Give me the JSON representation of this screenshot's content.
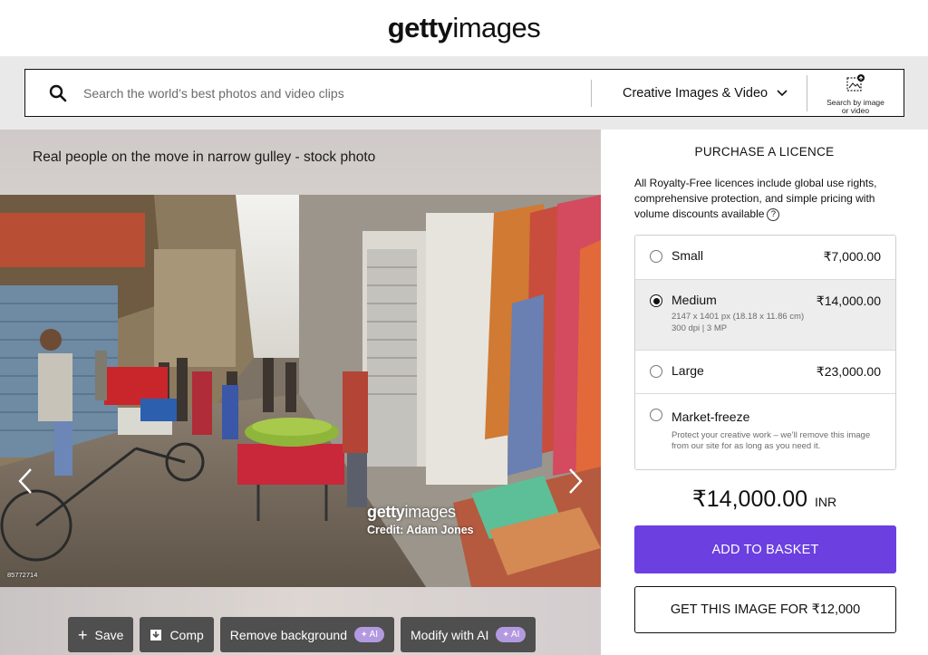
{
  "brand": {
    "bold": "getty",
    "light": "images"
  },
  "search": {
    "placeholder": "Search the world’s best photos and video clips",
    "scope_label": "Creative Images & Video",
    "image_search_label": "Search by image or video"
  },
  "asset": {
    "title": "Real people on the move in narrow gulley - stock photo",
    "watermark_bold": "getty",
    "watermark_light": "images",
    "credit": "Credit: Adam Jones",
    "image_id": "85772714"
  },
  "actions": {
    "save": "Save",
    "comp": "Comp",
    "remove_bg": "Remove background",
    "modify": "Modify with AI",
    "ai_badge": "AI"
  },
  "licence": {
    "heading": "PURCHASE A LICENCE",
    "intro": "All Royalty-Free licences include global use rights, comprehensive protection, and simple pricing with volume discounts available",
    "options": [
      {
        "name": "Small",
        "price": "₹7,000.00",
        "selected": false
      },
      {
        "name": "Medium",
        "price": "₹14,000.00",
        "detail1": "2147 x 1401 px (18.18 x 11.86 cm)",
        "detail2": "300 dpi | 3 MP",
        "selected": true
      },
      {
        "name": "Large",
        "price": "₹23,000.00",
        "selected": false
      },
      {
        "name": "Market-freeze",
        "detail1": "Protect your creative work – we’ll remove this image from our site for as long as you need it.",
        "selected": false
      }
    ],
    "total": "₹14,000.00",
    "currency": "INR",
    "add_button": "ADD TO BASKET",
    "alt_button": "GET THIS IMAGE FOR ₹12,000"
  },
  "colors": {
    "primary_button": "#6b3fe0",
    "ai_badge": "#b39ae0",
    "action_button": "#4f4f4f"
  },
  "icons": [
    "search-icon",
    "chevron-down-icon",
    "image-search-icon",
    "info-icon",
    "plus-icon",
    "download-icon",
    "sparkle-icon",
    "chevron-left-icon",
    "chevron-right-icon"
  ]
}
